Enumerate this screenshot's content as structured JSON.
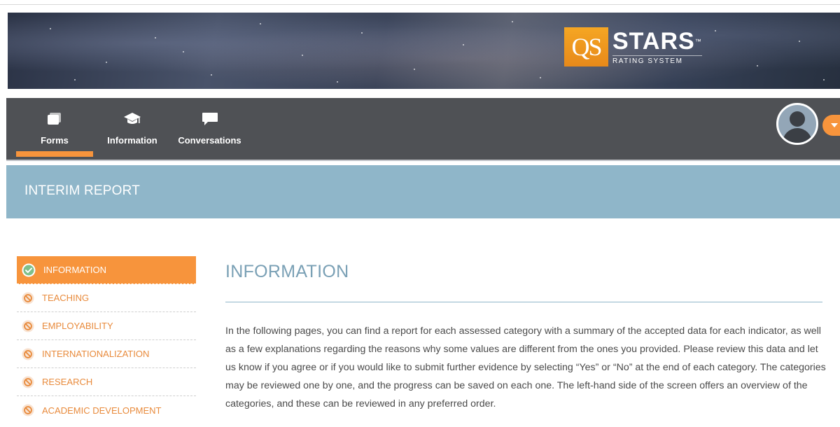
{
  "banner": {
    "logo_mark": "QS",
    "logo_title": "STARS",
    "logo_tm": "™",
    "logo_subtitle": "RATING SYSTEM"
  },
  "nav": {
    "items": [
      {
        "label": "Forms",
        "icon": "forms-icon",
        "active": true
      },
      {
        "label": "Information",
        "icon": "graduation-cap-icon",
        "active": false
      },
      {
        "label": "Conversations",
        "icon": "chat-bubble-icon",
        "active": false
      }
    ]
  },
  "user": {
    "avatar_icon": "user-avatar-icon",
    "menu_icon": "caret-down-icon"
  },
  "section": {
    "title": "INTERIM REPORT"
  },
  "sidebar": {
    "items": [
      {
        "label": "INFORMATION",
        "status_icon": "check-circle-icon",
        "active": true
      },
      {
        "label": "TEACHING",
        "status_icon": "blocked-icon",
        "active": false
      },
      {
        "label": "EMPLOYABILITY",
        "status_icon": "blocked-icon",
        "active": false
      },
      {
        "label": "INTERNATIONALIZATION",
        "status_icon": "blocked-icon",
        "active": false
      },
      {
        "label": "RESEARCH",
        "status_icon": "blocked-icon",
        "active": false
      },
      {
        "label": "ACADEMIC DEVELOPMENT",
        "status_icon": "blocked-icon",
        "active": false
      }
    ]
  },
  "main": {
    "title": "INFORMATION",
    "body": "In the following pages, you can find a report for each assessed category with a summary of the accepted data for each indicator, as well as a few explanations regarding the reasons why some values are different from the ones you provided. Please review this data and let us know if you agree or if you would like to submit further evidence by selecting “Yes” or “No” at the end of each category. The categories may be reviewed one by one, and the progress can be saved on each one. The left-hand side of the screen offers an overview of the categories, and these can be reviewed in any preferred order."
  },
  "colors": {
    "accent": "#f7943c",
    "navbar": "#4f5155",
    "band": "#8fb6c9",
    "title": "#7aa0b5",
    "text": "#4a4a4a"
  }
}
